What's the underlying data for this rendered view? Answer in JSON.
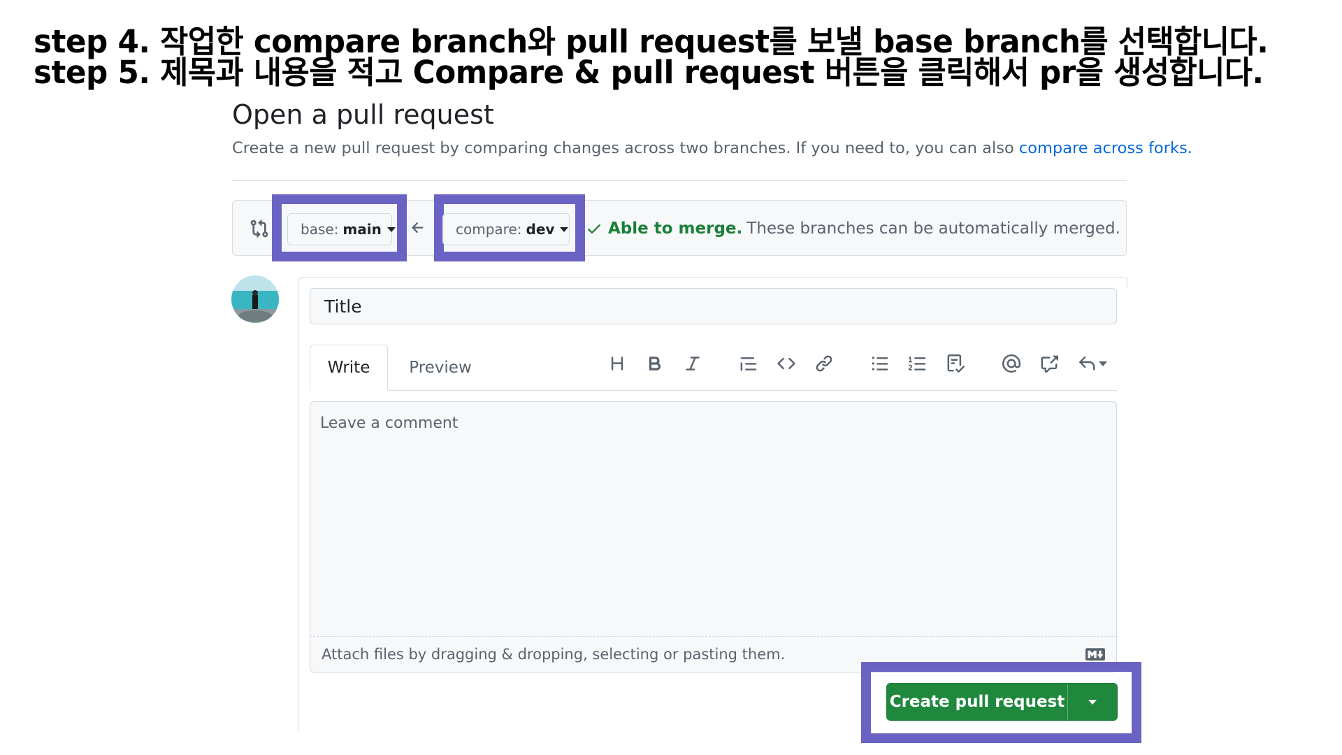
{
  "instructions": {
    "step4": "step 4. 작업한 compare branch와 pull request를 보낼 base branch를 선택합니다.",
    "step5": "step 5. 제목과 내용을 적고 Compare & pull request 버튼을 클릭해서 pr을 생성합니다."
  },
  "page": {
    "title": "Open a pull request",
    "subtitle": "Create a new pull request by comparing changes across two branches. If you need to, you can also ",
    "subtitle_link": "compare across forks."
  },
  "branches": {
    "base_prefix": "base:",
    "base_value": "main",
    "compare_prefix": "compare:",
    "compare_value": "dev",
    "merge_ok": "Able to merge.",
    "merge_text": "These branches can be automatically merged."
  },
  "form": {
    "title_placeholder": "Title",
    "tab_write": "Write",
    "tab_preview": "Preview",
    "comment_placeholder": "Leave a comment",
    "attach_text": "Attach files by dragging & dropping, selecting or pasting them.",
    "toolbar_icons": [
      "heading-icon",
      "bold-icon",
      "italic-icon",
      "quote-icon",
      "code-icon",
      "link-icon",
      "unordered-list-icon",
      "ordered-list-icon",
      "task-list-icon",
      "mention-icon",
      "cross-reference-icon",
      "undo-icon"
    ]
  },
  "actions": {
    "create_label": "Create pull request"
  },
  "colors": {
    "highlight": "#6b63c4",
    "primary_green": "#1f883d",
    "link_blue": "#0969da",
    "success_green": "#1a7f37"
  }
}
